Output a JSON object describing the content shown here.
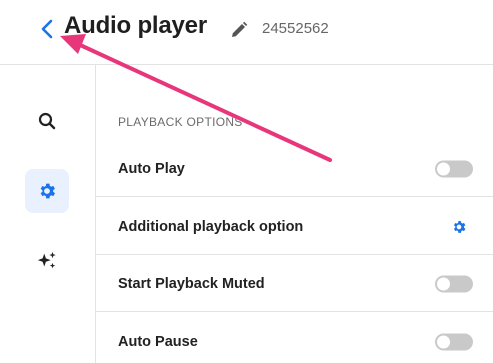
{
  "header": {
    "title": "Audio player",
    "page_id": "24552562",
    "back_icon": "chevron-left-icon",
    "edit_icon": "pencil-icon"
  },
  "sidebar": {
    "items": [
      {
        "name": "search",
        "icon": "search-icon",
        "active": false
      },
      {
        "name": "settings",
        "icon": "gear-icon",
        "active": true
      },
      {
        "name": "ai",
        "icon": "sparkles-icon",
        "active": false
      }
    ]
  },
  "main": {
    "section_heading": "PLAYBACK OPTIONS",
    "rows": [
      {
        "label": "Auto Play",
        "control": "toggle",
        "on": false
      },
      {
        "label": "Additional playback option",
        "control": "gear-icon"
      },
      {
        "label": "Start Playback Muted",
        "control": "toggle",
        "on": false
      },
      {
        "label": "Auto Pause",
        "control": "toggle",
        "on": false
      }
    ]
  },
  "colors": {
    "accent": "#1a73e8",
    "annotation": "#e8367a",
    "toggle_off": "#c9c9c9",
    "active_bg": "#e8f1fd"
  }
}
